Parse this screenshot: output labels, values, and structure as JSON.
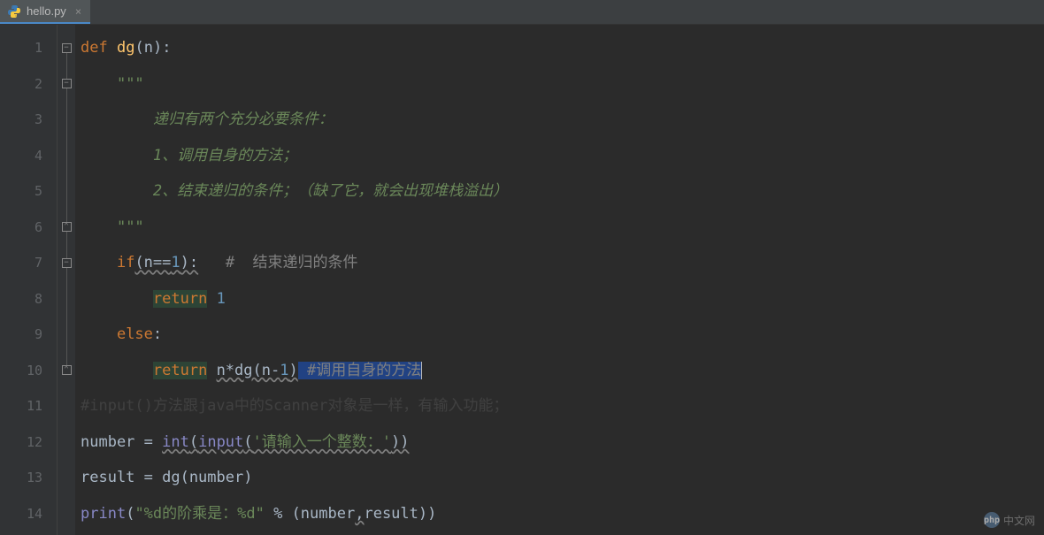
{
  "tab": {
    "filename": "hello.py",
    "close_glyph": "×"
  },
  "gutter": {
    "lines": [
      "1",
      "2",
      "3",
      "4",
      "5",
      "6",
      "7",
      "8",
      "9",
      "10",
      "11",
      "12",
      "13",
      "14"
    ]
  },
  "code": {
    "l1": {
      "kw_def": "def",
      "fn": "dg",
      "paren_open": "(",
      "param": "n",
      "paren_close_colon": "):"
    },
    "l2": {
      "doc": "\"\"\""
    },
    "l3": {
      "doc": "递归有两个充分必要条件："
    },
    "l4": {
      "doc": "1、调用自身的方法；"
    },
    "l5": {
      "doc": "2、结束递归的条件；（缺了它，就会出现堆栈溢出）"
    },
    "l6": {
      "doc": "\"\"\""
    },
    "l7": {
      "kw_if": "if",
      "cond": "(n==",
      "num": "1",
      "cond2": "):",
      "cmt": "#  结束递归的条件"
    },
    "l8": {
      "kw_return": "return",
      "num": "1"
    },
    "l9": {
      "kw_else": "else",
      "colon": ":"
    },
    "l10": {
      "kw_return": "return",
      "expr": "n*dg(n-",
      "num": "1",
      "paren": ")",
      "cmt_pre": " #",
      "cmt": "调用自身的方法"
    },
    "l11": {
      "cmt": "#input()方法跟java中的Scanner对象是一样，有输入功能；"
    },
    "l12": {
      "var": "number = ",
      "builtin1": "int",
      "p1": "(",
      "builtin2": "input",
      "p2": "(",
      "str": "'请输入一个整数：'",
      "p3": "))"
    },
    "l13": {
      "text": "result = dg(number)"
    },
    "l14": {
      "builtin": "print",
      "p1": "(",
      "str": "\"%d的阶乘是：%d\"",
      "mid": " % (number",
      "comma": ",",
      "rest": "result))"
    }
  },
  "watermark": {
    "logo": "php",
    "text": "中文网"
  }
}
